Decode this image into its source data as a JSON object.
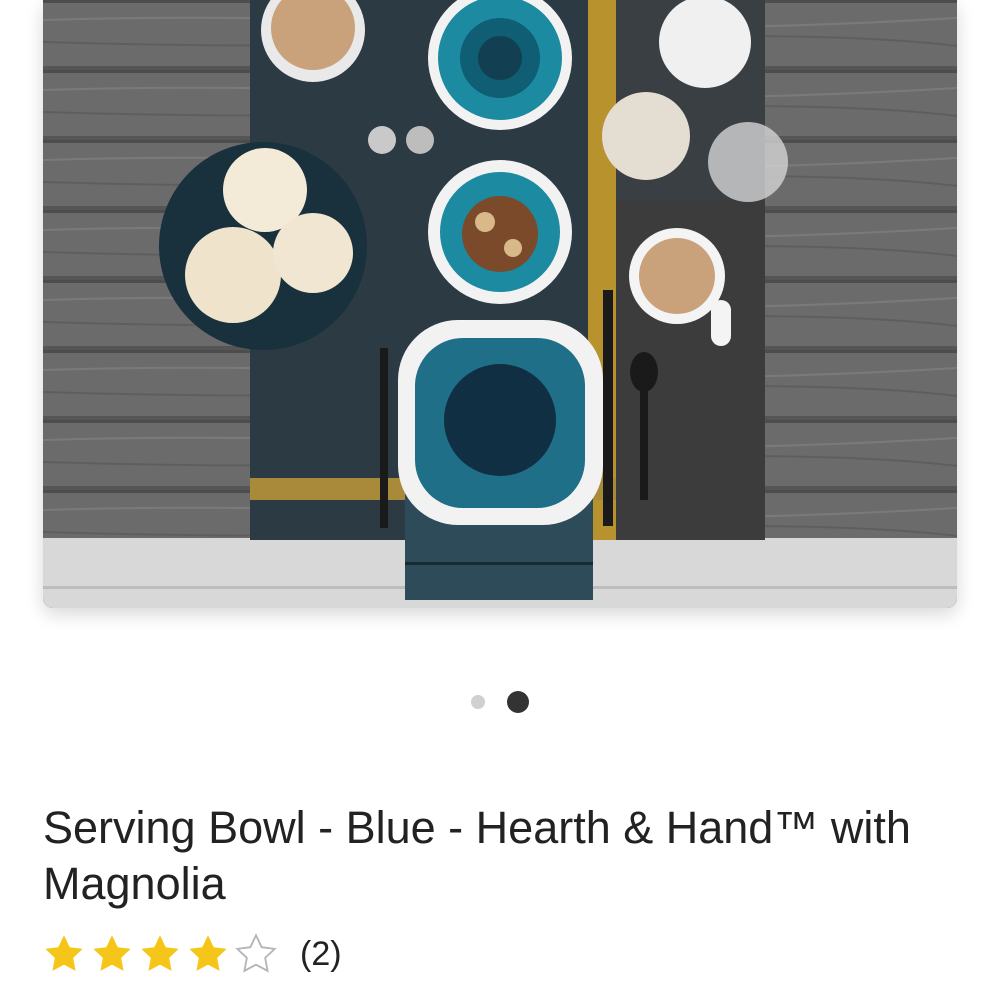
{
  "product": {
    "title": "Serving Bowl - Blue - Hearth & Hand™ with Magnolia",
    "rating": {
      "stars_filled": 4,
      "stars_total": 5,
      "review_count_text": "(2)"
    }
  },
  "carousel": {
    "total_images": 2,
    "active_index": 1
  },
  "colors": {
    "dot_inactive": "#d0d0d0",
    "dot_active": "#333333",
    "star_filled": "#f5c518",
    "star_empty_outline": "#b5b5b5",
    "text": "#222222"
  },
  "icons": {
    "star": "star-icon",
    "star_empty": "star-outline-icon"
  }
}
